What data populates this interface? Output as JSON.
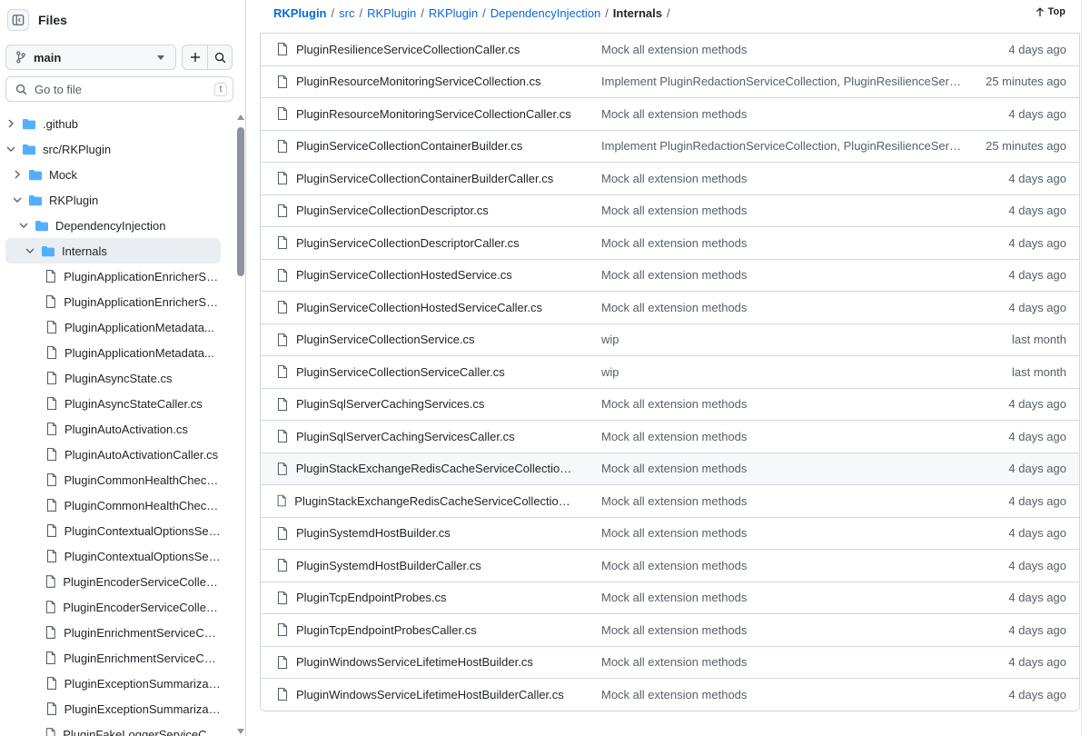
{
  "sidebar": {
    "title": "Files",
    "branch": "main",
    "goto_placeholder": "Go to file",
    "goto_shortcut": "t",
    "tree": [
      {
        "label": ".github",
        "kind": "folder",
        "depth": 0,
        "expanded": false
      },
      {
        "label": "src/RKPlugin",
        "kind": "folder",
        "depth": 0,
        "expanded": true
      },
      {
        "label": "Mock",
        "kind": "folder",
        "depth": 1,
        "expanded": false
      },
      {
        "label": "RKPlugin",
        "kind": "folder",
        "depth": 1,
        "expanded": true
      },
      {
        "label": "DependencyInjection",
        "kind": "folder",
        "depth": 2,
        "expanded": true
      },
      {
        "label": "Internals",
        "kind": "folder",
        "depth": 3,
        "expanded": true,
        "selected": true
      },
      {
        "label": "PluginApplicationEnricherSe...",
        "kind": "file",
        "depth": 4
      },
      {
        "label": "PluginApplicationEnricherSe...",
        "kind": "file",
        "depth": 4
      },
      {
        "label": "PluginApplicationMetadata...",
        "kind": "file",
        "depth": 4
      },
      {
        "label": "PluginApplicationMetadata...",
        "kind": "file",
        "depth": 4
      },
      {
        "label": "PluginAsyncState.cs",
        "kind": "file",
        "depth": 4
      },
      {
        "label": "PluginAsyncStateCaller.cs",
        "kind": "file",
        "depth": 4
      },
      {
        "label": "PluginAutoActivation.cs",
        "kind": "file",
        "depth": 4
      },
      {
        "label": "PluginAutoActivationCaller.cs",
        "kind": "file",
        "depth": 4
      },
      {
        "label": "PluginCommonHealthCheck...",
        "kind": "file",
        "depth": 4
      },
      {
        "label": "PluginCommonHealthCheck...",
        "kind": "file",
        "depth": 4
      },
      {
        "label": "PluginContextualOptionsSer...",
        "kind": "file",
        "depth": 4
      },
      {
        "label": "PluginContextualOptionsSer...",
        "kind": "file",
        "depth": 4
      },
      {
        "label": "PluginEncoderServiceCollect...",
        "kind": "file",
        "depth": 4
      },
      {
        "label": "PluginEncoderServiceCollect...",
        "kind": "file",
        "depth": 4
      },
      {
        "label": "PluginEnrichmentServiceCol...",
        "kind": "file",
        "depth": 4
      },
      {
        "label": "PluginEnrichmentServiceCol...",
        "kind": "file",
        "depth": 4
      },
      {
        "label": "PluginExceptionSummarizat...",
        "kind": "file",
        "depth": 4
      },
      {
        "label": "PluginExceptionSummarizat...",
        "kind": "file",
        "depth": 4
      },
      {
        "label": "PluginFakeLoggerServiceCol...",
        "kind": "file",
        "depth": 4
      }
    ]
  },
  "breadcrumb": {
    "segments": [
      "RKPlugin",
      "src",
      "RKPlugin",
      "RKPlugin",
      "DependencyInjection"
    ],
    "current": "Internals",
    "separator": "/",
    "top_label": "Top"
  },
  "files": [
    {
      "name": "PluginResilienceServiceCollectionCaller.cs",
      "message": "Mock all extension methods",
      "date": "4 days ago"
    },
    {
      "name": "PluginResourceMonitoringServiceCollection.cs",
      "message": "Implement PluginRedactionServiceCollection, PluginResilienceServiceCollection...",
      "date": "25 minutes ago"
    },
    {
      "name": "PluginResourceMonitoringServiceCollectionCaller.cs",
      "message": "Mock all extension methods",
      "date": "4 days ago"
    },
    {
      "name": "PluginServiceCollectionContainerBuilder.cs",
      "message": "Implement PluginRedactionServiceCollection, PluginResilienceServiceCollection...",
      "date": "25 minutes ago"
    },
    {
      "name": "PluginServiceCollectionContainerBuilderCaller.cs",
      "message": "Mock all extension methods",
      "date": "4 days ago"
    },
    {
      "name": "PluginServiceCollectionDescriptor.cs",
      "message": "Mock all extension methods",
      "date": "4 days ago"
    },
    {
      "name": "PluginServiceCollectionDescriptorCaller.cs",
      "message": "Mock all extension methods",
      "date": "4 days ago"
    },
    {
      "name": "PluginServiceCollectionHostedService.cs",
      "message": "Mock all extension methods",
      "date": "4 days ago"
    },
    {
      "name": "PluginServiceCollectionHostedServiceCaller.cs",
      "message": "Mock all extension methods",
      "date": "4 days ago"
    },
    {
      "name": "PluginServiceCollectionService.cs",
      "message": "wip",
      "date": "last month"
    },
    {
      "name": "PluginServiceCollectionServiceCaller.cs",
      "message": "wip",
      "date": "last month"
    },
    {
      "name": "PluginSqlServerCachingServices.cs",
      "message": "Mock all extension methods",
      "date": "4 days ago"
    },
    {
      "name": "PluginSqlServerCachingServicesCaller.cs",
      "message": "Mock all extension methods",
      "date": "4 days ago"
    },
    {
      "name": "PluginStackExchangeRedisCacheServiceCollection.cs",
      "message": "Mock all extension methods",
      "date": "4 days ago",
      "hover": true
    },
    {
      "name": "PluginStackExchangeRedisCacheServiceCollectionCaller.cs",
      "message": "Mock all extension methods",
      "date": "4 days ago"
    },
    {
      "name": "PluginSystemdHostBuilder.cs",
      "message": "Mock all extension methods",
      "date": "4 days ago"
    },
    {
      "name": "PluginSystemdHostBuilderCaller.cs",
      "message": "Mock all extension methods",
      "date": "4 days ago"
    },
    {
      "name": "PluginTcpEndpointProbes.cs",
      "message": "Mock all extension methods",
      "date": "4 days ago"
    },
    {
      "name": "PluginTcpEndpointProbesCaller.cs",
      "message": "Mock all extension methods",
      "date": "4 days ago"
    },
    {
      "name": "PluginWindowsServiceLifetimeHostBuilder.cs",
      "message": "Mock all extension methods",
      "date": "4 days ago"
    },
    {
      "name": "PluginWindowsServiceLifetimeHostBuilderCaller.cs",
      "message": "Mock all extension methods",
      "date": "4 days ago"
    }
  ],
  "colors": {
    "link": "#0969da",
    "folder": "#54aeff",
    "muted": "#57606a",
    "border": "#d0d7de",
    "selected_bg": "#eaeef2"
  }
}
